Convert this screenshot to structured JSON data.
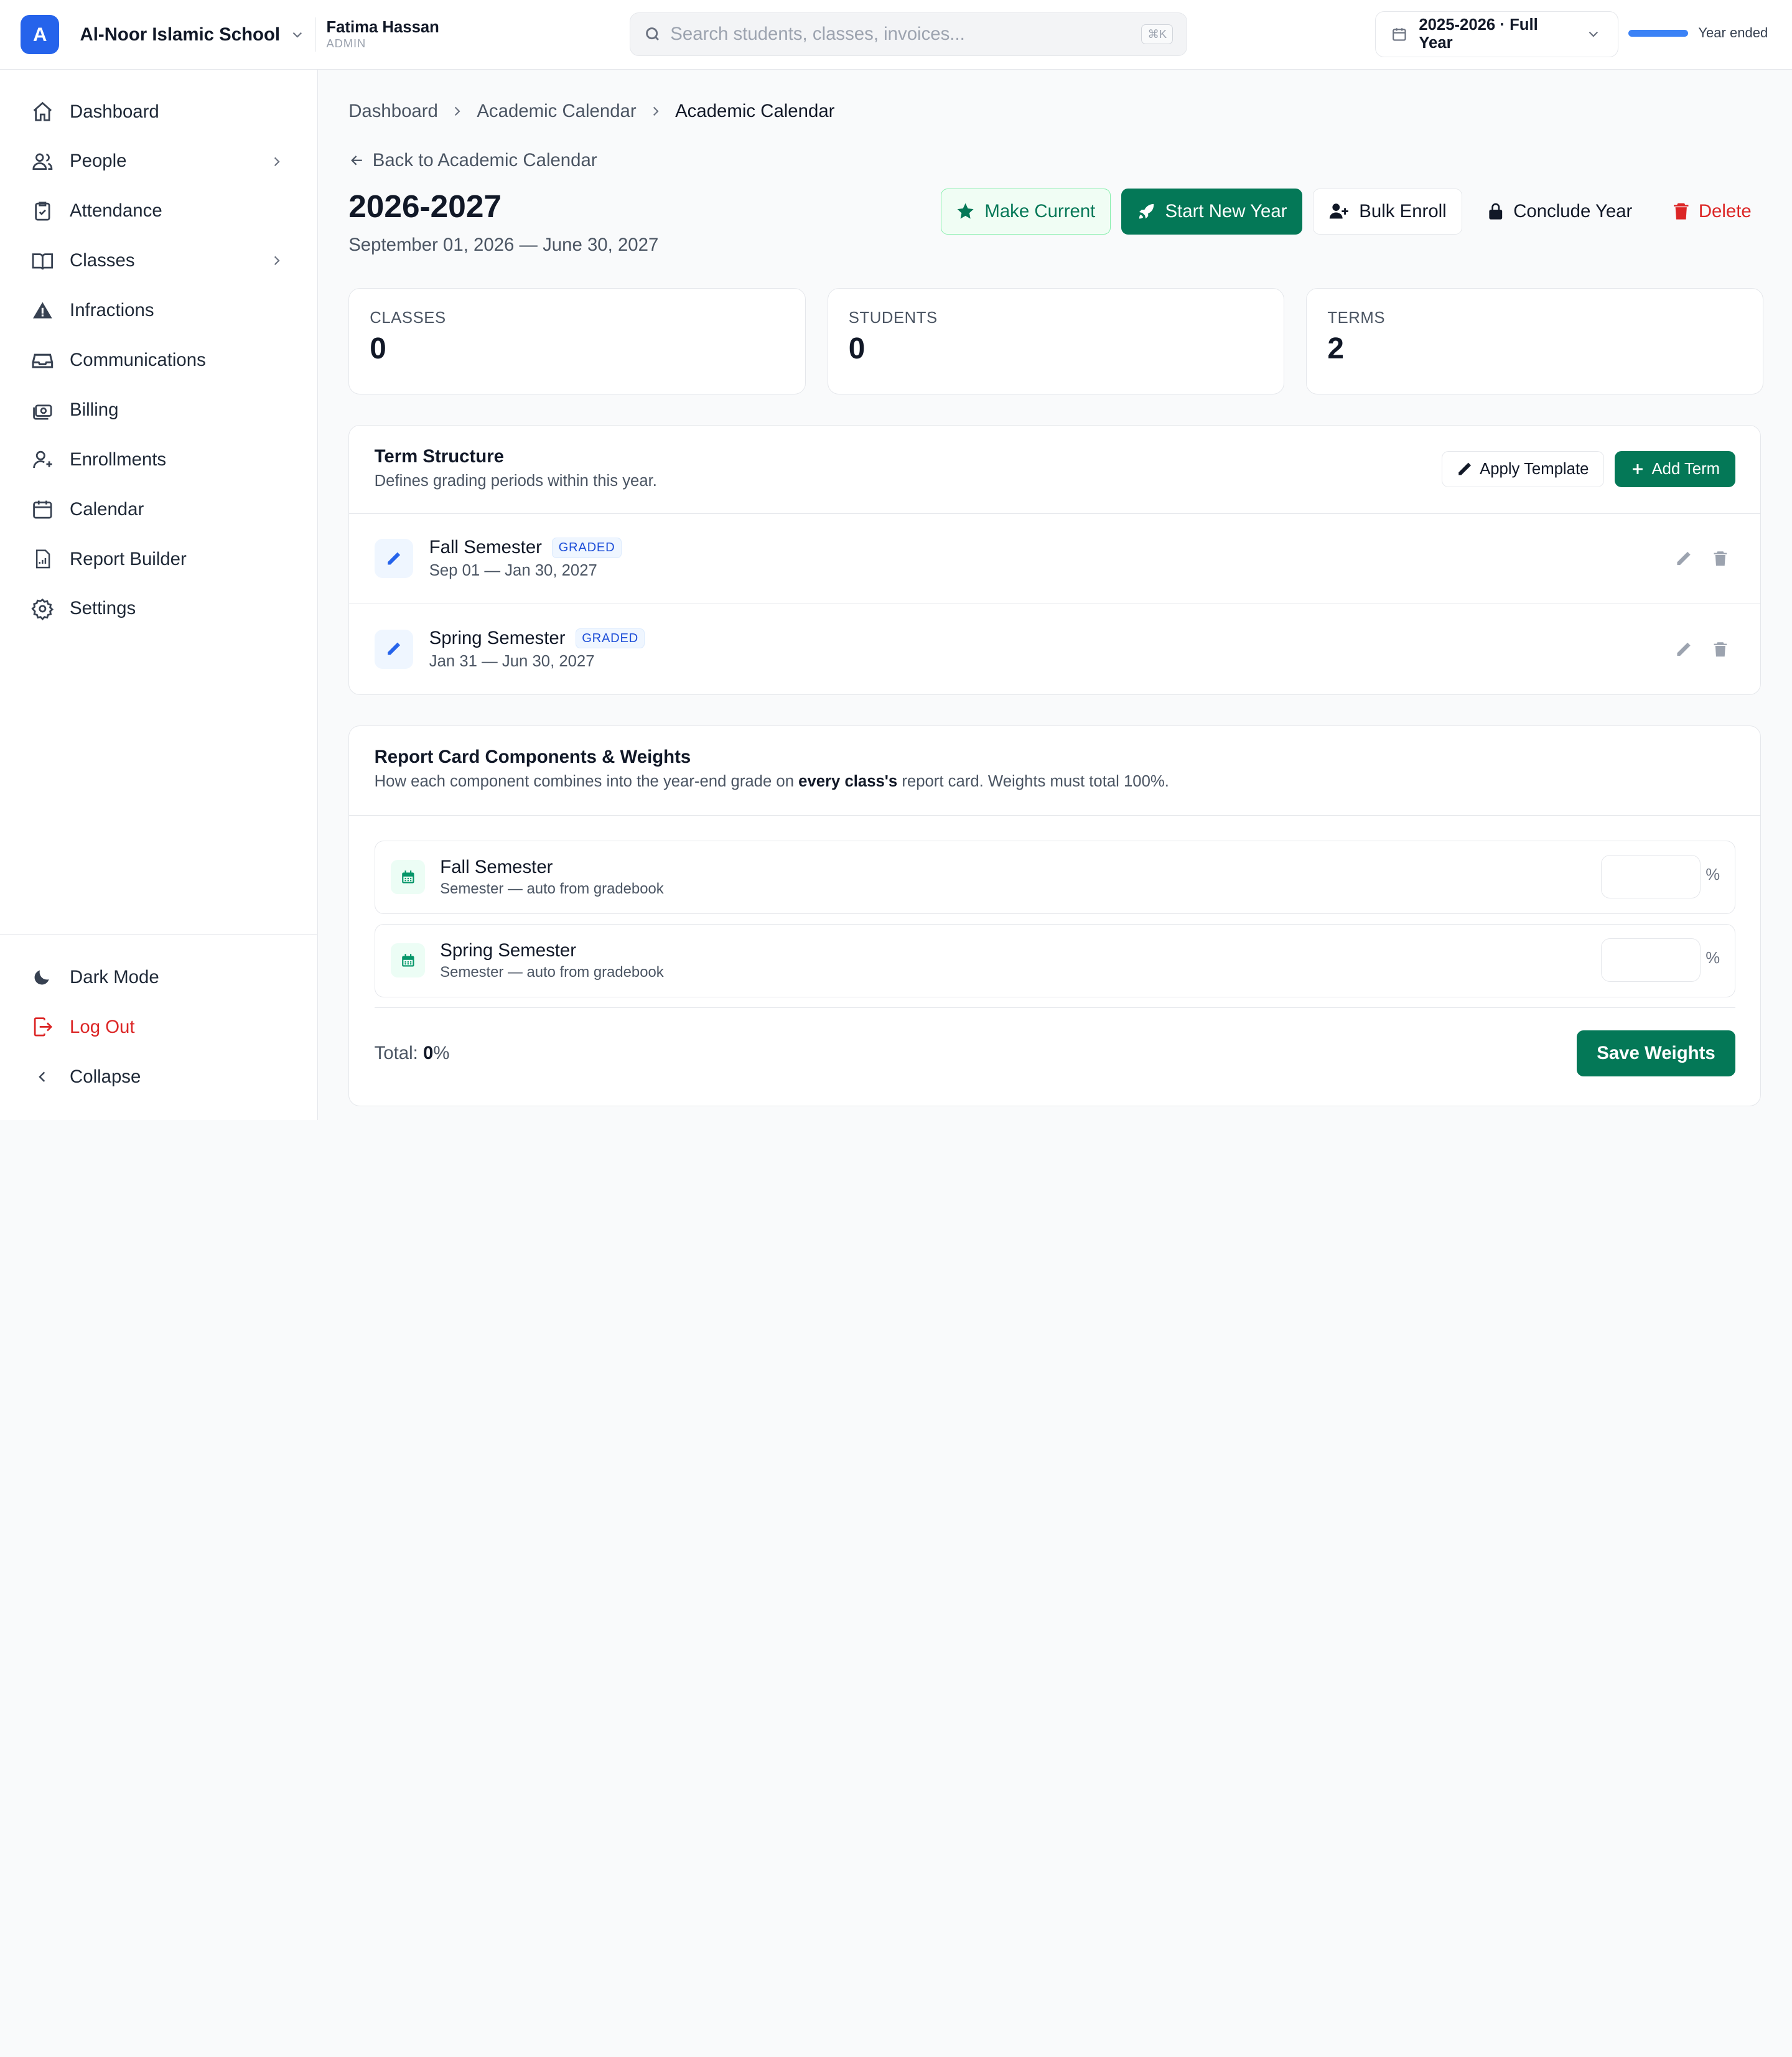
{
  "topbar": {
    "logo_letter": "A",
    "school_name": "Al-Noor Islamic School",
    "user_name": "Fatima Hassan",
    "user_role": "ADMIN",
    "search_placeholder": "Search students, classes, invoices...",
    "search_shortcut": "⌘K",
    "year_label": "2025-2026 · Full Year",
    "year_progress": 1.0,
    "year_status": "Year ended"
  },
  "sidebar": {
    "items": [
      {
        "label": "Dashboard",
        "icon": "home-icon"
      },
      {
        "label": "People",
        "icon": "users-icon",
        "expandable": true
      },
      {
        "label": "Attendance",
        "icon": "clipboard-check-icon"
      },
      {
        "label": "Classes",
        "icon": "book-open-icon",
        "expandable": true
      },
      {
        "label": "Infractions",
        "icon": "warning-icon"
      },
      {
        "label": "Communications",
        "icon": "inbox-icon"
      },
      {
        "label": "Billing",
        "icon": "money-icon"
      },
      {
        "label": "Enrollments",
        "icon": "user-plus-icon"
      },
      {
        "label": "Calendar",
        "icon": "calendar-icon"
      },
      {
        "label": "Report Builder",
        "icon": "report-icon"
      },
      {
        "label": "Settings",
        "icon": "gear-icon"
      }
    ],
    "bottom": {
      "dark_mode": "Dark Mode",
      "logout": "Log Out",
      "collapse": "Collapse"
    }
  },
  "breadcrumb": [
    "Dashboard",
    "Academic Calendar",
    "Academic Calendar"
  ],
  "back_link": "Back to Academic Calendar",
  "page": {
    "title": "2026-2027",
    "subtitle": "September 01, 2026 — June 30, 2027"
  },
  "actions": {
    "make_current": "Make Current",
    "start_new_year": "Start New Year",
    "bulk_enroll": "Bulk Enroll",
    "conclude_year": "Conclude Year",
    "delete": "Delete"
  },
  "stats": [
    {
      "label": "CLASSES",
      "value": "0"
    },
    {
      "label": "STUDENTS",
      "value": "0"
    },
    {
      "label": "TERMS",
      "value": "2"
    }
  ],
  "terms": {
    "title": "Term Structure",
    "description": "Defines grading periods within this year.",
    "apply_template": "Apply Template",
    "add_term": "Add Term",
    "rows": [
      {
        "name": "Fall Semester",
        "badge": "GRADED",
        "dates": "Sep 01 — Jan 30, 2027"
      },
      {
        "name": "Spring Semester",
        "badge": "GRADED",
        "dates": "Jan 31 — Jun 30, 2027"
      }
    ]
  },
  "weights": {
    "title": "Report Card Components & Weights",
    "description_pre": "How each component combines into the year-end grade on ",
    "description_bold": "every class's",
    "description_post": " report card. Weights must total 100%.",
    "components": [
      {
        "name": "Fall Semester",
        "sub": "Semester — auto from gradebook",
        "value": "",
        "unit": "%"
      },
      {
        "name": "Spring Semester",
        "sub": "Semester — auto from gradebook",
        "value": "",
        "unit": "%"
      }
    ],
    "total_label": "Total: ",
    "total_value": "0",
    "total_unit": "%",
    "save_label": "Save Weights"
  }
}
